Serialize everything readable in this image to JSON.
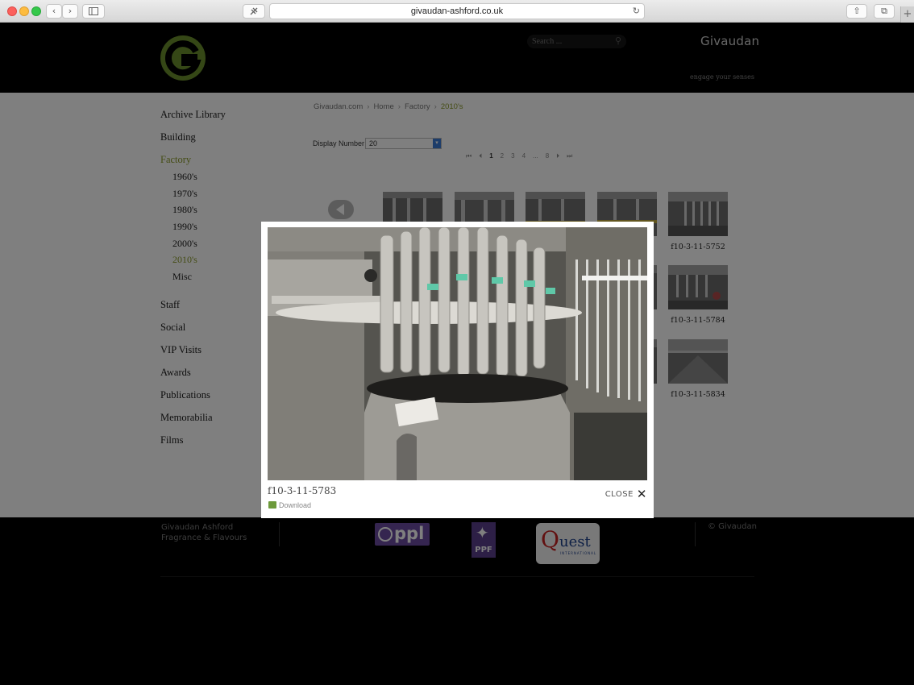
{
  "browser": {
    "url": "givaudan-ashford.co.uk",
    "back_icon": "‹",
    "forward_icon": "›",
    "reload_icon": "↻",
    "share_icon": "⇧",
    "tabs_icon": "⧉",
    "new_tab_icon": "+"
  },
  "header": {
    "search_placeholder": "Search ...",
    "brand": "Givaudan",
    "tagline": "engage your senses"
  },
  "nav": {
    "items": [
      {
        "label": "Archive Library"
      },
      {
        "label": "Building"
      },
      {
        "label": "Factory"
      },
      {
        "label": "1960's"
      },
      {
        "label": "1970's"
      },
      {
        "label": "1980's"
      },
      {
        "label": "1990's"
      },
      {
        "label": "2000's"
      },
      {
        "label": "2010's"
      },
      {
        "label": "Misc"
      },
      {
        "label": "Staff"
      },
      {
        "label": "Social"
      },
      {
        "label": "VIP Visits"
      },
      {
        "label": "Awards"
      },
      {
        "label": "Publications"
      },
      {
        "label": "Memorabilia"
      },
      {
        "label": "Films"
      }
    ]
  },
  "breadcrumb": {
    "items": [
      "Givaudan.com",
      "Home",
      "Factory",
      "2010's"
    ],
    "separator": "›"
  },
  "display": {
    "label": "Display Number",
    "value": "20"
  },
  "pager": {
    "first": "⏮",
    "prev": "⏴",
    "pages": [
      "1",
      "2",
      "3",
      "4",
      "...",
      "8"
    ],
    "next": "⏵",
    "last": "⏭"
  },
  "thumbnails": {
    "labels": [
      "f10-3-11-5752",
      "f10-3-11-5784",
      "f10-3-11-5834"
    ]
  },
  "footer": {
    "line1": "Givaudan Ashford",
    "line2": "Fragrance & Flavours",
    "copyright": "© Givaudan",
    "ppl": "ppl",
    "ppf": "PPF",
    "quest_q": "Q",
    "quest_rest": "uest",
    "quest_small": "INTERNATIONAL"
  },
  "lightbox": {
    "caption": "f10-3-11-5783",
    "download": "Download",
    "close": "CLOSE",
    "close_icon": "✕"
  },
  "colors": {
    "accent": "#8a9a2a",
    "logo": "#6a8f2c"
  }
}
